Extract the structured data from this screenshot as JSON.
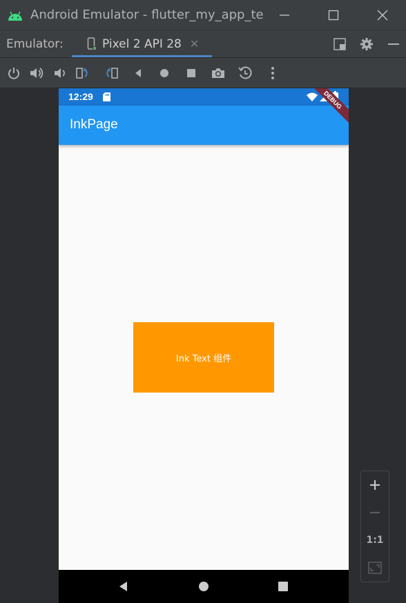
{
  "window": {
    "title": "Android Emulator - flutter_my_app_te"
  },
  "tabbar": {
    "label": "Emulator:",
    "active_tab": "Pixel 2 API 28"
  },
  "device": {
    "status_time": "12:29",
    "app_title": "InkPage",
    "debug_banner": "DEBUG",
    "ink_text": "Ink Text 组件",
    "ink_color": "#ff9800",
    "appbar_color": "#2196f3"
  },
  "zoom": {
    "reset_label": "1:1"
  }
}
